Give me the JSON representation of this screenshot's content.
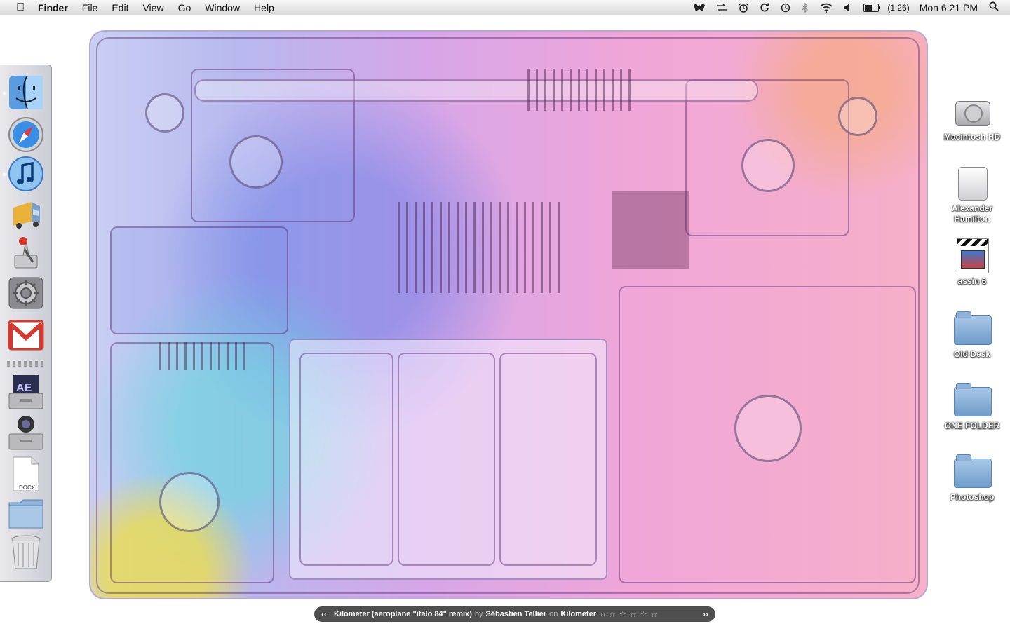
{
  "menubar": {
    "app_name": "Finder",
    "menus": [
      "File",
      "Edit",
      "View",
      "Go",
      "Window",
      "Help"
    ],
    "status_icons": [
      "bat-icon",
      "sync-arrows-icon",
      "alarm-clock-icon",
      "refresh-icon",
      "time-machine-icon",
      "bluetooth-icon",
      "wifi-icon",
      "volume-icon"
    ],
    "battery": {
      "text": "(1:26)",
      "level": 0.55
    },
    "clock": "Mon 6:21 PM"
  },
  "dock": {
    "items": [
      {
        "name": "finder",
        "running": true
      },
      {
        "name": "safari",
        "running": false
      },
      {
        "name": "itunes",
        "running": true
      },
      {
        "name": "transmit",
        "running": false
      },
      {
        "name": "automator",
        "running": false
      },
      {
        "name": "system-preferences",
        "running": false
      },
      {
        "name": "gmail",
        "running": false
      }
    ],
    "stack_items": [
      {
        "name": "after-effects",
        "text": "AE"
      },
      {
        "name": "camera-drawer"
      },
      {
        "name": "docx-file",
        "text": "DOCX"
      },
      {
        "name": "folder-stack"
      },
      {
        "name": "trash"
      }
    ]
  },
  "desktop": {
    "icons": [
      {
        "label": "Macintosh HD",
        "type": "hard-drive"
      },
      {
        "label": "Alexander Hamilton",
        "type": "external-drive"
      },
      {
        "label": "assin 6",
        "type": "movie-file"
      },
      {
        "label": "Old Desk",
        "type": "folder"
      },
      {
        "label": "ONE FOLDER",
        "type": "folder"
      },
      {
        "label": "Photoshop",
        "type": "folder"
      }
    ]
  },
  "now_playing": {
    "prev": "‹‹",
    "title": "Kilometer (aeroplane \"italo 84\" remix)",
    "by": "by",
    "artist": "Sébastien Tellier",
    "on": "on",
    "album": "Kilometer",
    "rating": "○ ☆ ☆ ☆ ☆ ☆",
    "next": "››"
  },
  "colors": {
    "menubar_bg": "#e6e6e6",
    "folder_blue": "#8fb3d8",
    "gmail_red": "#d23a2f"
  }
}
